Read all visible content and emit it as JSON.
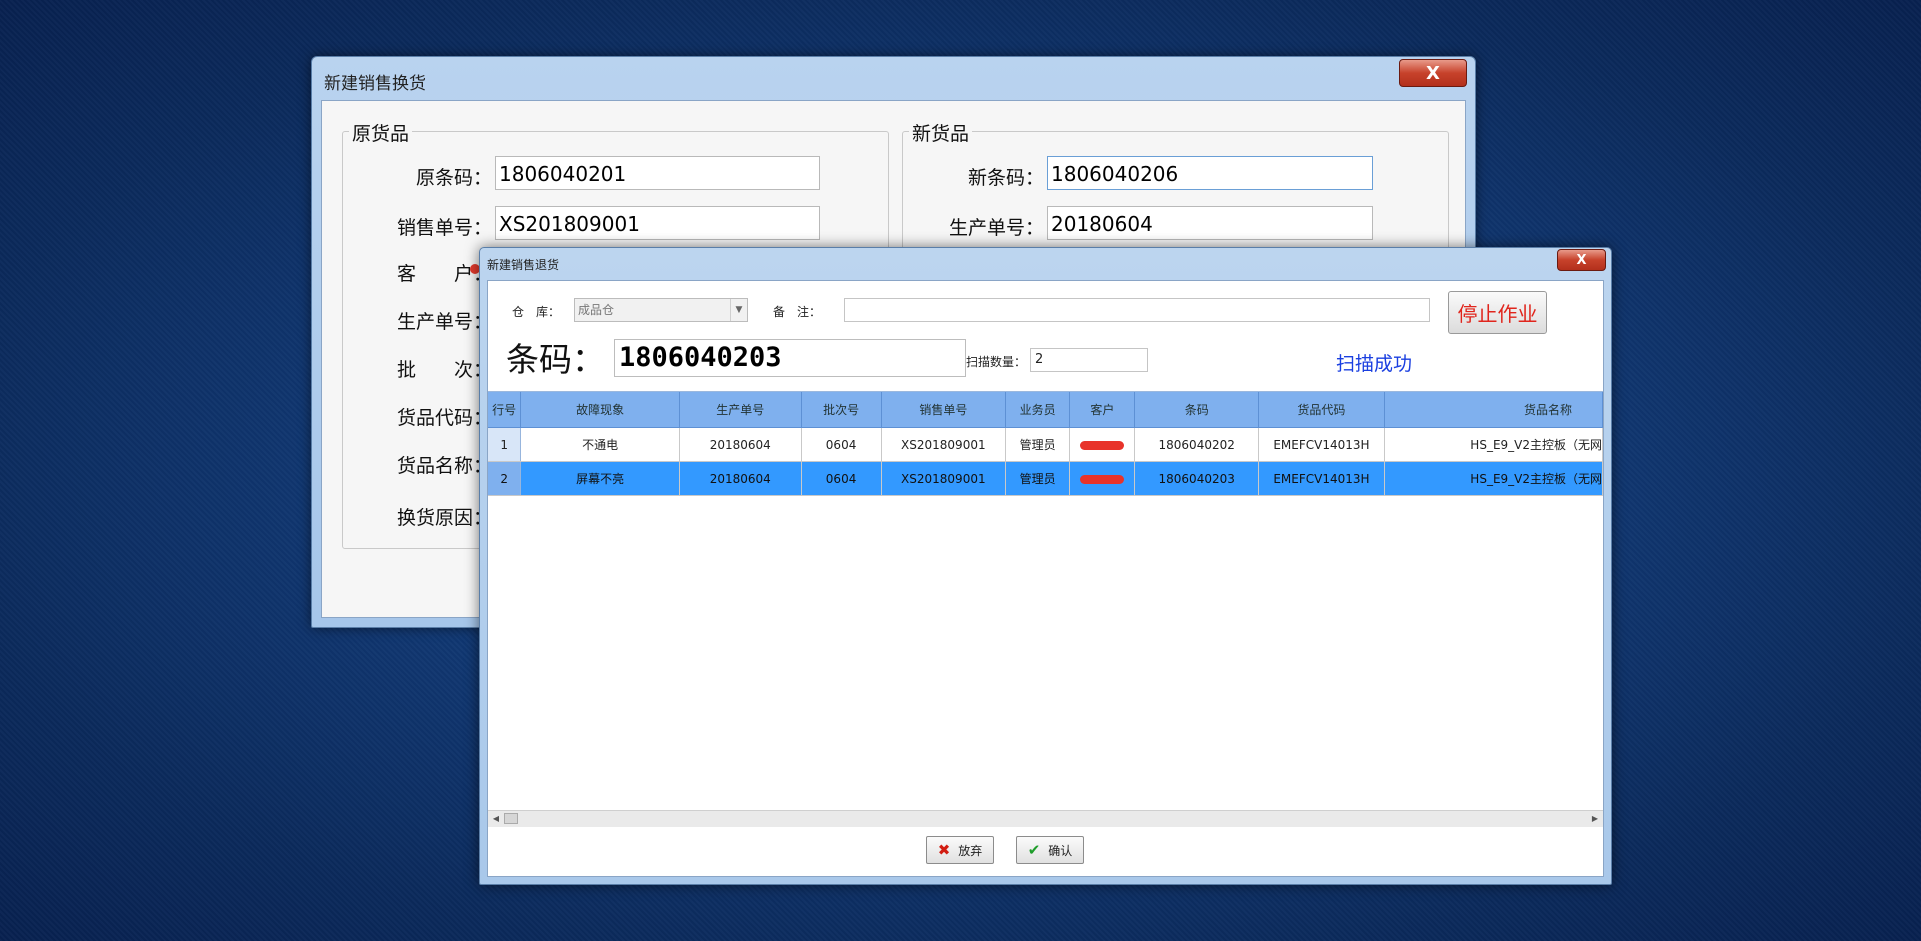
{
  "exchange_window": {
    "title": "新建销售换货",
    "close_label": "X",
    "original_group": {
      "legend": "原货品",
      "fields": [
        {
          "label": "原条码：",
          "value": "1806040201"
        },
        {
          "label": "销售单号：",
          "value": "XS201809001"
        },
        {
          "label": "客　　户："
        },
        {
          "label": "生产单号："
        },
        {
          "label": "批　　次："
        },
        {
          "label": "货品代码："
        },
        {
          "label": "货品名称："
        },
        {
          "label": "换货原因："
        }
      ]
    },
    "new_group": {
      "legend": "新货品",
      "fields": [
        {
          "label": "新条码：",
          "value": "1806040206"
        },
        {
          "label": "生产单号：",
          "value": "20180604"
        }
      ]
    }
  },
  "return_window": {
    "title": "新建销售退货",
    "close_label": "X",
    "warehouse_label": "仓　库：",
    "warehouse_value": "成品仓",
    "note_label": "备　注：",
    "note_value": "",
    "stop_button": "停止作业",
    "barcode_label": "条码：",
    "barcode_value": "1806040203",
    "scan_count_label": "扫描数量：",
    "scan_count_value": "2",
    "scan_status": "扫描成功",
    "columns": [
      "行号",
      "故障现象",
      "生产单号",
      "批次号",
      "销售单号",
      "业务员",
      "客户",
      "条码",
      "货品代码",
      "货品名称"
    ],
    "rows": [
      {
        "num": "1",
        "fault": "不通电",
        "prod_no": "20180604",
        "batch": "0604",
        "sales_no": "XS201809001",
        "salesman": "管理员",
        "barcode": "1806040202",
        "code": "EMEFCV14013H",
        "name": "HS_E9_V2主控板（无网"
      },
      {
        "num": "2",
        "fault": "屏幕不亮",
        "prod_no": "20180604",
        "batch": "0604",
        "sales_no": "XS201809001",
        "salesman": "管理员",
        "barcode": "1806040203",
        "code": "EMEFCV14013H",
        "name": "HS_E9_V2主控板（无网"
      }
    ],
    "selected_row": 2,
    "cancel_button": "放弃",
    "confirm_button": "确认"
  },
  "colors": {
    "desktop": "#123c7a",
    "grid_header": "#7fb0ee",
    "selected_row": "#3399ff",
    "stop_text": "#e0251c",
    "status_text": "#1a3fe0"
  }
}
